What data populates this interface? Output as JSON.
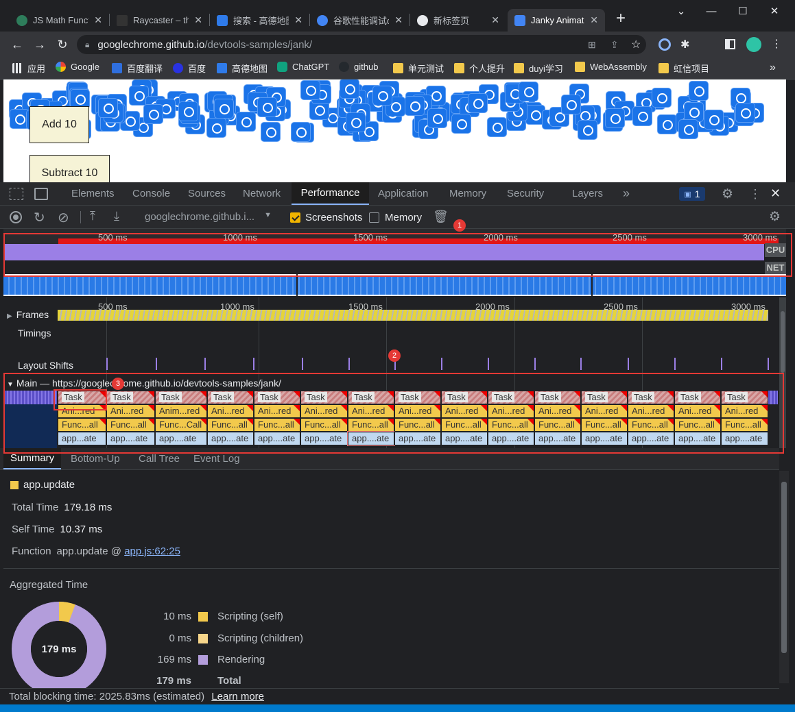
{
  "browser": {
    "tabs": [
      {
        "title": "JS Math Functi",
        "fav": "#2e7d5b"
      },
      {
        "title": "Raycaster – th",
        "fav": "#333333"
      },
      {
        "title": "搜索 - 高德地图",
        "fav": "#2f7bea"
      },
      {
        "title": "谷歌性能调试d",
        "fav": "#4285f4"
      },
      {
        "title": "新标签页",
        "fav": "#e8eaed"
      },
      {
        "title": "Janky Animati",
        "fav": "#4285f4"
      }
    ],
    "new_tab": "+",
    "url_host": "googlechrome.github.io",
    "url_path": "/devtools-samples/jank/",
    "bookmarks": [
      "应用",
      "Google",
      "百度翻译",
      "百度",
      "高德地图",
      "ChatGPT",
      "github",
      "单元测试",
      "个人提升",
      "duyi学习",
      "WebAssembly",
      "虹信项目"
    ],
    "bookmarks_more": "»"
  },
  "page": {
    "add_label": "Add 10",
    "subtract_label": "Subtract 10"
  },
  "devtools": {
    "tabs": [
      "Elements",
      "Console",
      "Sources",
      "Network",
      "Performance",
      "Application",
      "Memory",
      "Security",
      "Layers"
    ],
    "active_tab": "Performance",
    "more_tabs": "»",
    "issues_count": "1",
    "perf_toolbar": {
      "url_select": "googlechrome.github.i...",
      "screenshots_label": "Screenshots",
      "screenshots_checked": true,
      "memory_label": "Memory",
      "memory_checked": false
    },
    "overview": {
      "ticks": [
        "500 ms",
        "1000 ms",
        "1500 ms",
        "2000 ms",
        "2500 ms",
        "3000 ms"
      ],
      "cpu_label": "CPU",
      "net_label": "NET"
    },
    "timeline": {
      "ticks": [
        "500 ms",
        "1000 ms",
        "1500 ms",
        "2000 ms",
        "2500 ms",
        "3000 ms"
      ],
      "frames_label": "Frames",
      "timings_label": "Timings",
      "layout_shifts_label": "Layout Shifts",
      "main_label": "Main — https://googlechrome.github.io/devtools-samples/jank/",
      "task_label": "Task",
      "anim_labels": [
        "Ani...red",
        "Ani...red",
        "Anim...red",
        "Ani...red",
        "Ani...red",
        "Ani...red",
        "Ani...red",
        "Ani...red",
        "Ani...red",
        "Ani...red",
        "Ani...red",
        "Ani...red",
        "Ani...red",
        "Ani...red",
        "Ani...red"
      ],
      "func_labels": [
        "Func...all",
        "Func...all",
        "Func...Call",
        "Func...all",
        "Func...all",
        "Func...all",
        "Func...all",
        "Func...all",
        "Func...all",
        "Func...all",
        "Func...all",
        "Func...all",
        "Func...all",
        "Func...all",
        "Func...all"
      ],
      "app_labels": [
        "app...ate",
        "app....ate",
        "app....ate",
        "app....ate",
        "app....ate",
        "app....ate",
        "app....ate",
        "app....ate",
        "app....ate",
        "app....ate",
        "app....ate",
        "app....ate",
        "app....ate",
        "app....ate",
        "app....ate"
      ]
    },
    "bottom_tabs": [
      "Summary",
      "Bottom-Up",
      "Call Tree",
      "Event Log"
    ],
    "summary": {
      "title": "app.update",
      "total_time_label": "Total Time",
      "total_time": "179.18 ms",
      "self_time_label": "Self Time",
      "self_time": "10.37 ms",
      "function_label": "Function",
      "function_value": "app.update @",
      "function_link": "app.js:62:25",
      "aggregated_title": "Aggregated Time",
      "donut_center": "179 ms",
      "legend": [
        {
          "value": "10 ms",
          "label": "Scripting (self)",
          "color": "#f2c94c"
        },
        {
          "value": "0 ms",
          "label": "Scripting (children)",
          "color": "#f6d58a"
        },
        {
          "value": "169 ms",
          "label": "Rendering",
          "color": "#b39ddb"
        },
        {
          "value": "179 ms",
          "label": "Total",
          "color": ""
        }
      ]
    },
    "status": {
      "text": "Total blocking time: 2025.83ms (estimated)",
      "link": "Learn more"
    }
  },
  "annotations": [
    "1",
    "2",
    "3"
  ],
  "colors": {
    "accent": "#8ab4f8",
    "task_red": "#e53935",
    "cpu_purple": "#9b7fe6",
    "scripting": "#f2c94c",
    "rendering": "#b39ddb"
  }
}
